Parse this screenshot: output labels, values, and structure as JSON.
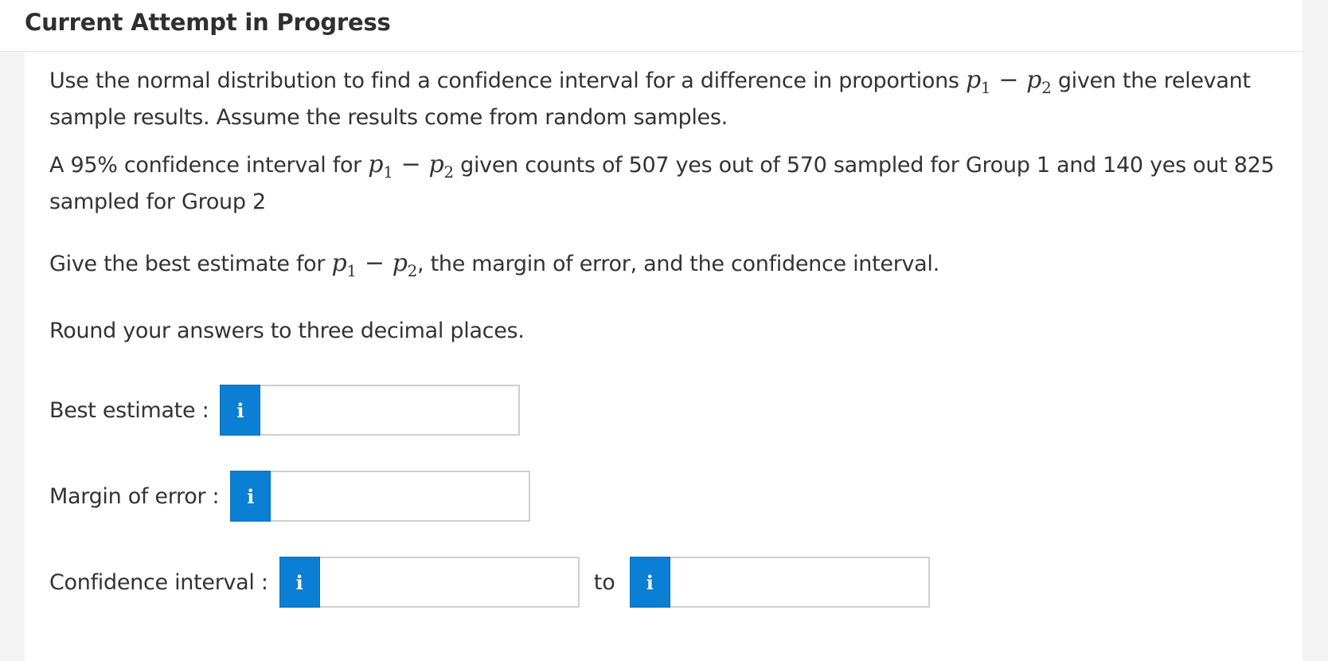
{
  "header": {
    "title": "Current Attempt in Progress"
  },
  "question": {
    "intro_part1": "Use the normal distribution to find a confidence interval for a difference in proportions",
    "intro_part2": "given the relevant sample results. Assume the results come from random samples.",
    "detail_part1": "A 95% confidence interval for",
    "detail_part2": "given counts of 507 yes out of 570 sampled for Group 1 and 140 yes out 825 sampled for Group 2",
    "ask_part1": "Give the best estimate for",
    "ask_part2": ", the margin of error, and the confidence interval.",
    "rounding": "Round your answers to three decimal places.",
    "math": {
      "p": "p",
      "sub1": "1",
      "sub2": "2",
      "minus": "−"
    }
  },
  "answers": {
    "best_estimate_label": "Best estimate :",
    "margin_of_error_label": "Margin of error :",
    "confidence_interval_label": "Confidence interval :",
    "to_label": "to",
    "info_glyph": "i",
    "best_estimate_value": "",
    "margin_of_error_value": "",
    "ci_lower_value": "",
    "ci_upper_value": ""
  },
  "colors": {
    "info_button": "#0b7fd3",
    "page_background": "#f3f3f3",
    "panel_background": "#ffffff"
  }
}
